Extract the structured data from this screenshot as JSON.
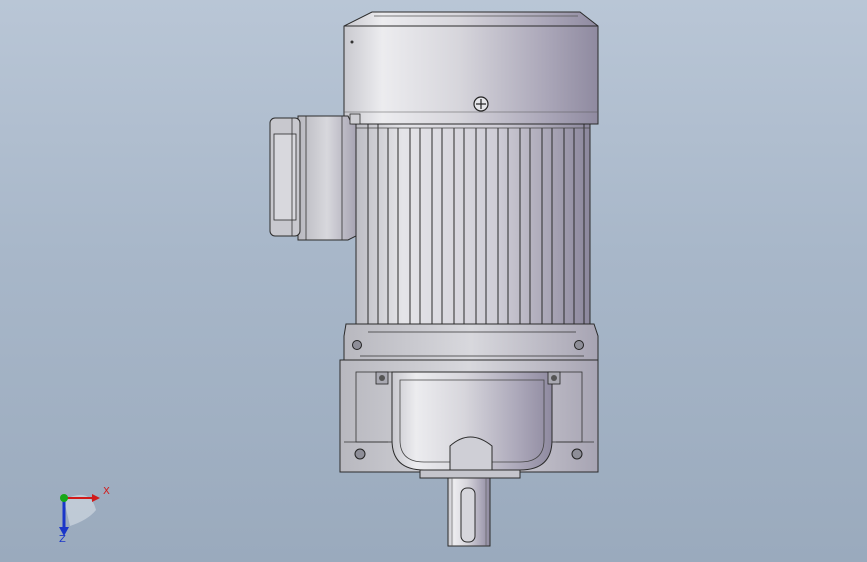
{
  "viewport": {
    "background_top": "#b9c6d6",
    "background_bottom": "#9aaabd"
  },
  "model": {
    "name_icon": "electric-gear-motor-model",
    "body_color": "#d9d9de",
    "shade_color": "#8d8aa0",
    "outline_color": "#2b2b2b"
  },
  "triad": {
    "x_label": "X",
    "z_label": "Z",
    "x_color": "#d11a1a",
    "y_color": "#18a818",
    "z_color": "#1a36c9"
  }
}
